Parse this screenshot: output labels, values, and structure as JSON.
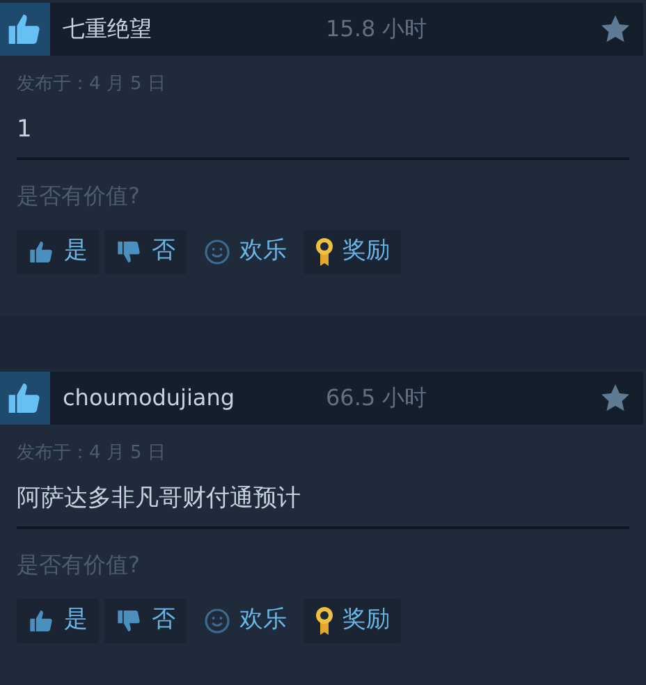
{
  "reviews": [
    {
      "recommended": true,
      "author": "七重绝望",
      "hours": "15.8 小时",
      "posted": "发布于：4 月 5 日",
      "body": "1",
      "question": "是否有价值?",
      "buttons": [
        {
          "kind": "up",
          "label": "是"
        },
        {
          "kind": "down",
          "label": "否"
        },
        {
          "kind": "funny",
          "label": "欢乐"
        },
        {
          "kind": "award",
          "label": "奖励"
        }
      ]
    },
    {
      "recommended": true,
      "author": "choumodujiang",
      "hours": "66.5 小时",
      "posted": "发布于：4 月 5 日",
      "body": "阿萨达多非凡哥财付通预计",
      "question": "是否有价值?",
      "buttons": [
        {
          "kind": "up",
          "label": "是"
        },
        {
          "kind": "down",
          "label": "否"
        },
        {
          "kind": "funny",
          "label": "欢乐"
        },
        {
          "kind": "award",
          "label": "奖励"
        }
      ]
    }
  ]
}
